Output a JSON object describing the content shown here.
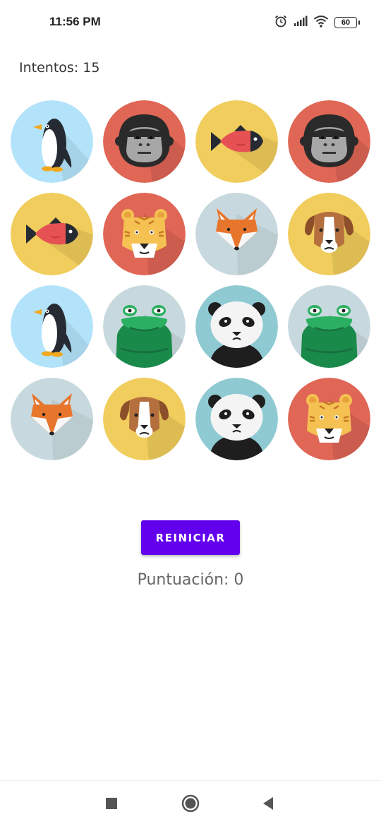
{
  "status_bar": {
    "time": "11:56 PM",
    "battery": "60",
    "icons": [
      "alarm-icon",
      "signal-icon",
      "wifi-icon",
      "battery-icon"
    ]
  },
  "game": {
    "attempts_label": "Intentos: 15",
    "cards": [
      [
        "penguin",
        "gorilla",
        "fish",
        "gorilla"
      ],
      [
        "fish",
        "tiger",
        "fox",
        "dog"
      ],
      [
        "penguin",
        "frog",
        "panda",
        "frog"
      ],
      [
        "fox",
        "dog",
        "panda",
        "tiger"
      ]
    ],
    "reset_label": "REINICIAR",
    "score_label": "Puntuación: 0"
  },
  "colors": {
    "accent": "#6200ee",
    "penguin_bg": "#b3e3fa",
    "gorilla_bg": "#e06656",
    "fish_bg": "#f0cd5c",
    "tiger_bg": "#e06656",
    "fox_bg": "#c7d9de",
    "dog_bg": "#f0cd5c",
    "frog_bg": "#c7d9de",
    "panda_bg": "#8fcad3"
  },
  "nav_bar": {
    "icons": [
      "recents-square-icon",
      "home-circle-icon",
      "back-triangle-icon"
    ]
  }
}
